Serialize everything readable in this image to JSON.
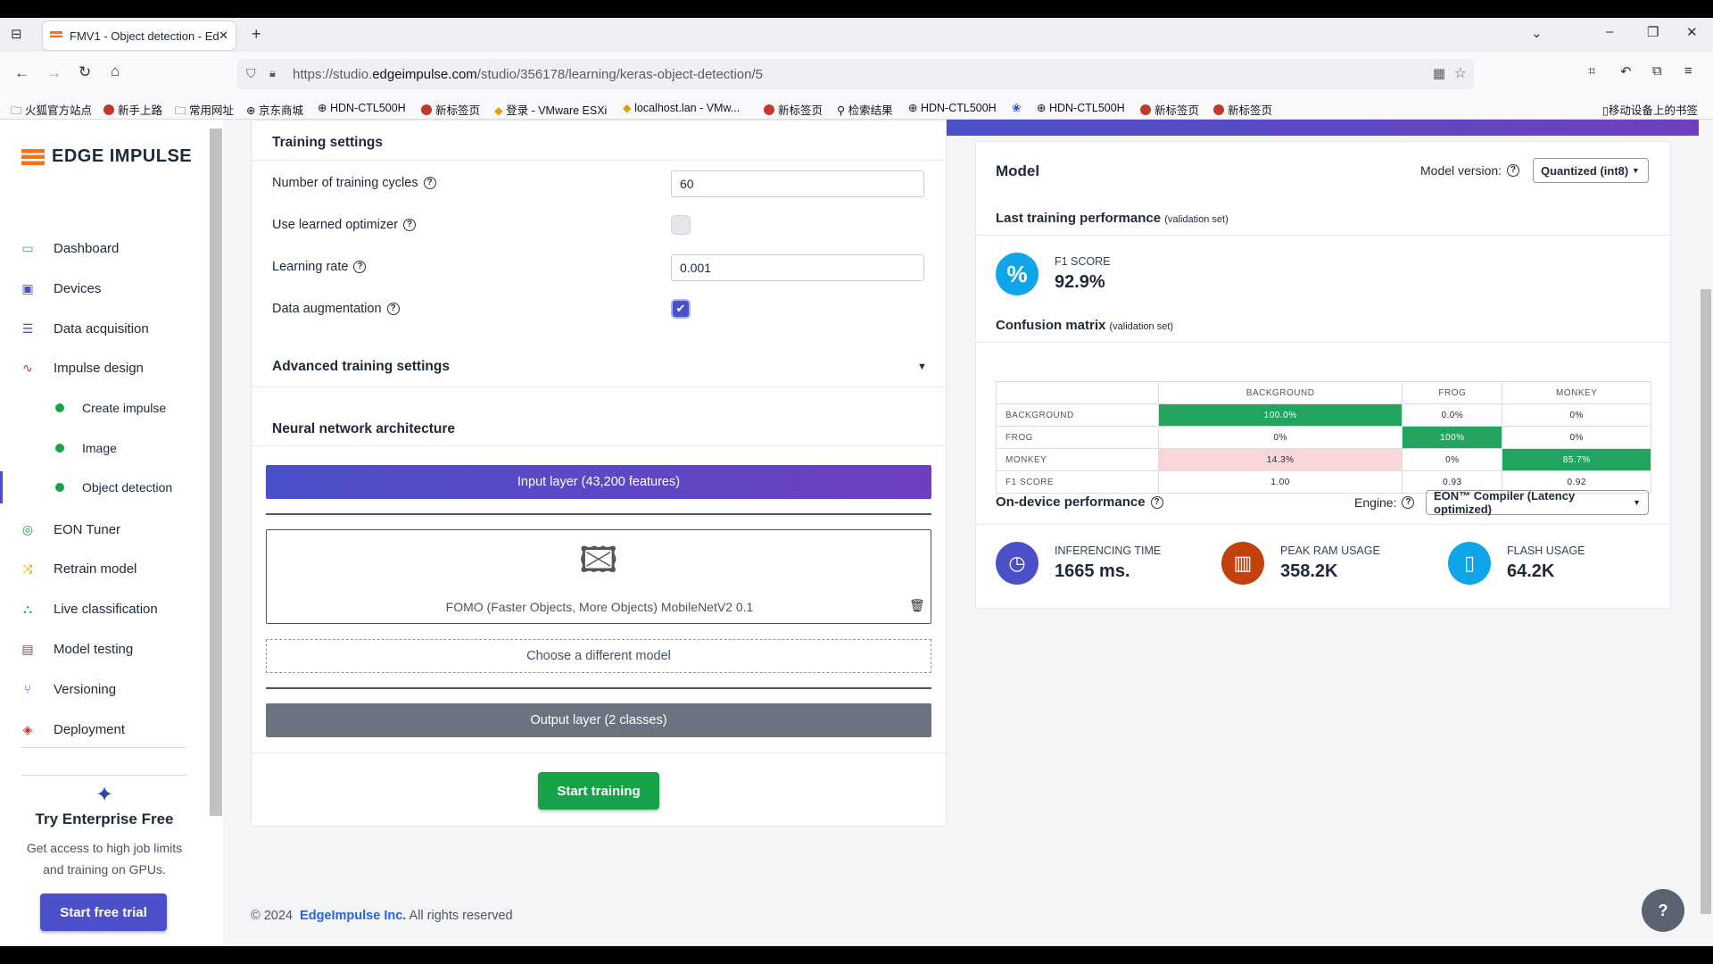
{
  "browser": {
    "tab_title": "FMV1 - Object detection - Ed",
    "url_prefix": "https://studio.",
    "url_domain": "edgeimpulse.com",
    "url_path": "/studio/356178/learning/keras-object-detection/5"
  },
  "bookmarks": [
    "火狐官方站点",
    "新手上路",
    "常用网址",
    "京东商城",
    "HDN-CTL500H",
    "新标签页",
    "登录 - VMware ESXi",
    "localhost.lan - VMw...",
    "新标签页",
    "检索结果",
    "HDN-CTL500H",
    "HDN-CTL500H",
    "新标签页",
    "新标签页"
  ],
  "bookmarks_mobile": "移动设备上的书签",
  "sidebar": {
    "logo": "EDGE IMPULSE",
    "items": [
      "Dashboard",
      "Devices",
      "Data acquisition",
      "Impulse design"
    ],
    "sub_items": [
      "Create impulse",
      "Image",
      "Object detection"
    ],
    "items2": [
      "EON Tuner",
      "Retrain model",
      "Live classification",
      "Model testing",
      "Versioning",
      "Deployment"
    ],
    "enterprise": {
      "title": "Try Enterprise Free",
      "line1": "Get access to high job limits",
      "line2": "and training on GPUs.",
      "button": "Start free trial"
    }
  },
  "training": {
    "title": "Training settings",
    "cycles_label": "Number of training cycles",
    "cycles_value": "60",
    "optimizer_label": "Use learned optimizer",
    "lr_label": "Learning rate",
    "lr_value": "0.001",
    "aug_label": "Data augmentation",
    "advanced": "Advanced training settings",
    "nn_title": "Neural network architecture",
    "input_layer": "Input layer (43,200 features)",
    "model_name": "FOMO (Faster Objects, More Objects) MobileNetV2 0.1",
    "choose": "Choose a different model",
    "output_layer": "Output layer (2 classes)",
    "start": "Start training"
  },
  "model": {
    "title": "Model",
    "version_label": "Model version:",
    "version_value": "Quantized (int8)",
    "last_perf": "Last training performance",
    "validation_set": "(validation set)",
    "f1_label": "F1 SCORE",
    "f1_value": "92.9%",
    "cm_title": "Confusion matrix",
    "cm_cols": [
      "BACKGROUND",
      "FROG",
      "MONKEY"
    ],
    "cm_rows": [
      {
        "label": "BACKGROUND",
        "vals": [
          "100.0%",
          "0.0%",
          "0%"
        ]
      },
      {
        "label": "FROG",
        "vals": [
          "0%",
          "100%",
          "0%"
        ]
      },
      {
        "label": "MONKEY",
        "vals": [
          "14.3%",
          "0%",
          "85.7%"
        ]
      },
      {
        "label": "F1 SCORE",
        "vals": [
          "1.00",
          "0.93",
          "0.92"
        ]
      }
    ],
    "ondevice": "On-device performance",
    "engine_label": "Engine:",
    "engine_value": "EON™ Compiler (Latency optimized)",
    "inf_label": "INFERENCING TIME",
    "inf_value": "1665 ms.",
    "ram_label": "PEAK RAM USAGE",
    "ram_value": "358.2K",
    "flash_label": "FLASH USAGE",
    "flash_value": "64.2K"
  },
  "footer": {
    "copy": "© 2024",
    "company": "EdgeImpulse Inc.",
    "rights": "All rights reserved"
  },
  "colors": {
    "accent": "#4b50c8",
    "green": "#16a34a"
  }
}
